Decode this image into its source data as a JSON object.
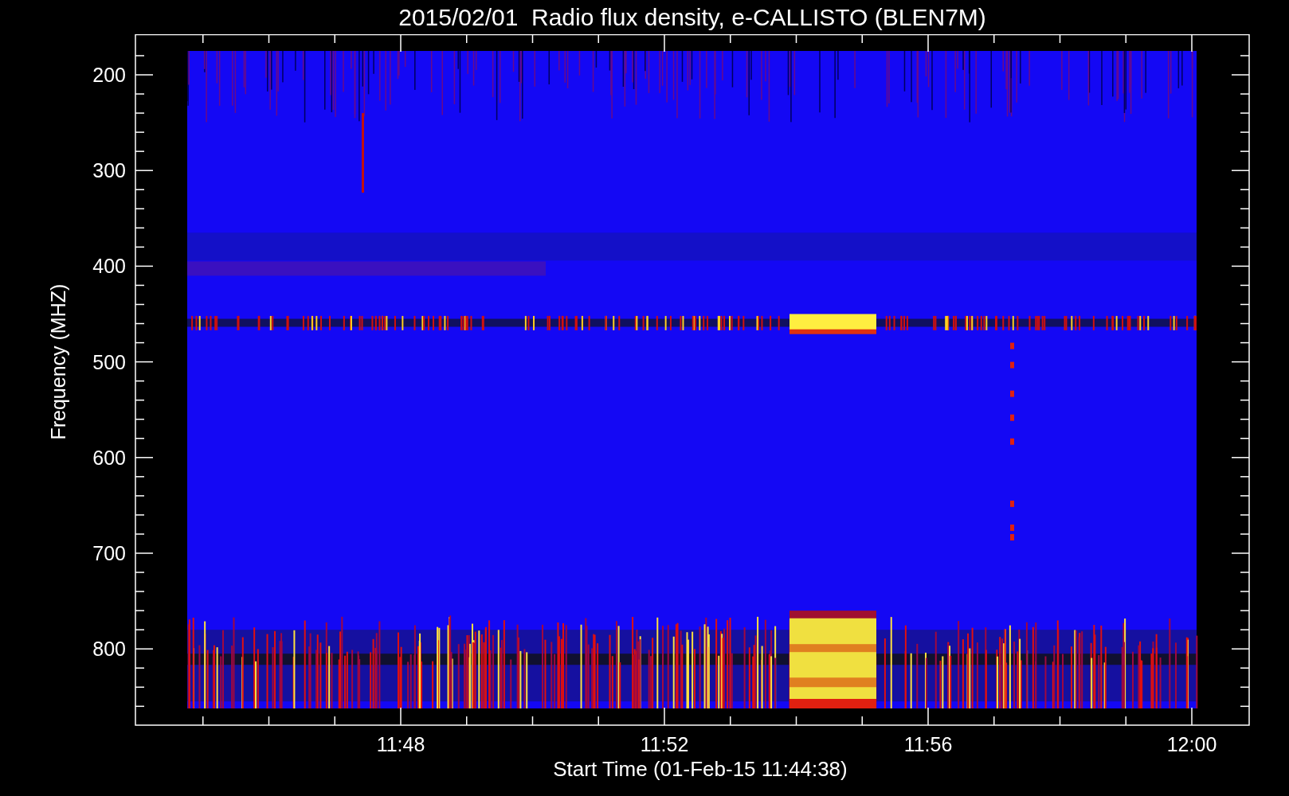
{
  "title": "2015/02/01  Radio flux density, e-CALLISTO (BLEN7M)",
  "y_axis": {
    "label": "Frequency (MHZ)",
    "ticks": [
      "200",
      "300",
      "400",
      "500",
      "600",
      "700",
      "800"
    ]
  },
  "x_axis": {
    "label": "Start Time (01-Feb-15 11:44:38)",
    "ticks": [
      "11:48",
      "11:52",
      "11:56",
      "12:00"
    ]
  }
}
